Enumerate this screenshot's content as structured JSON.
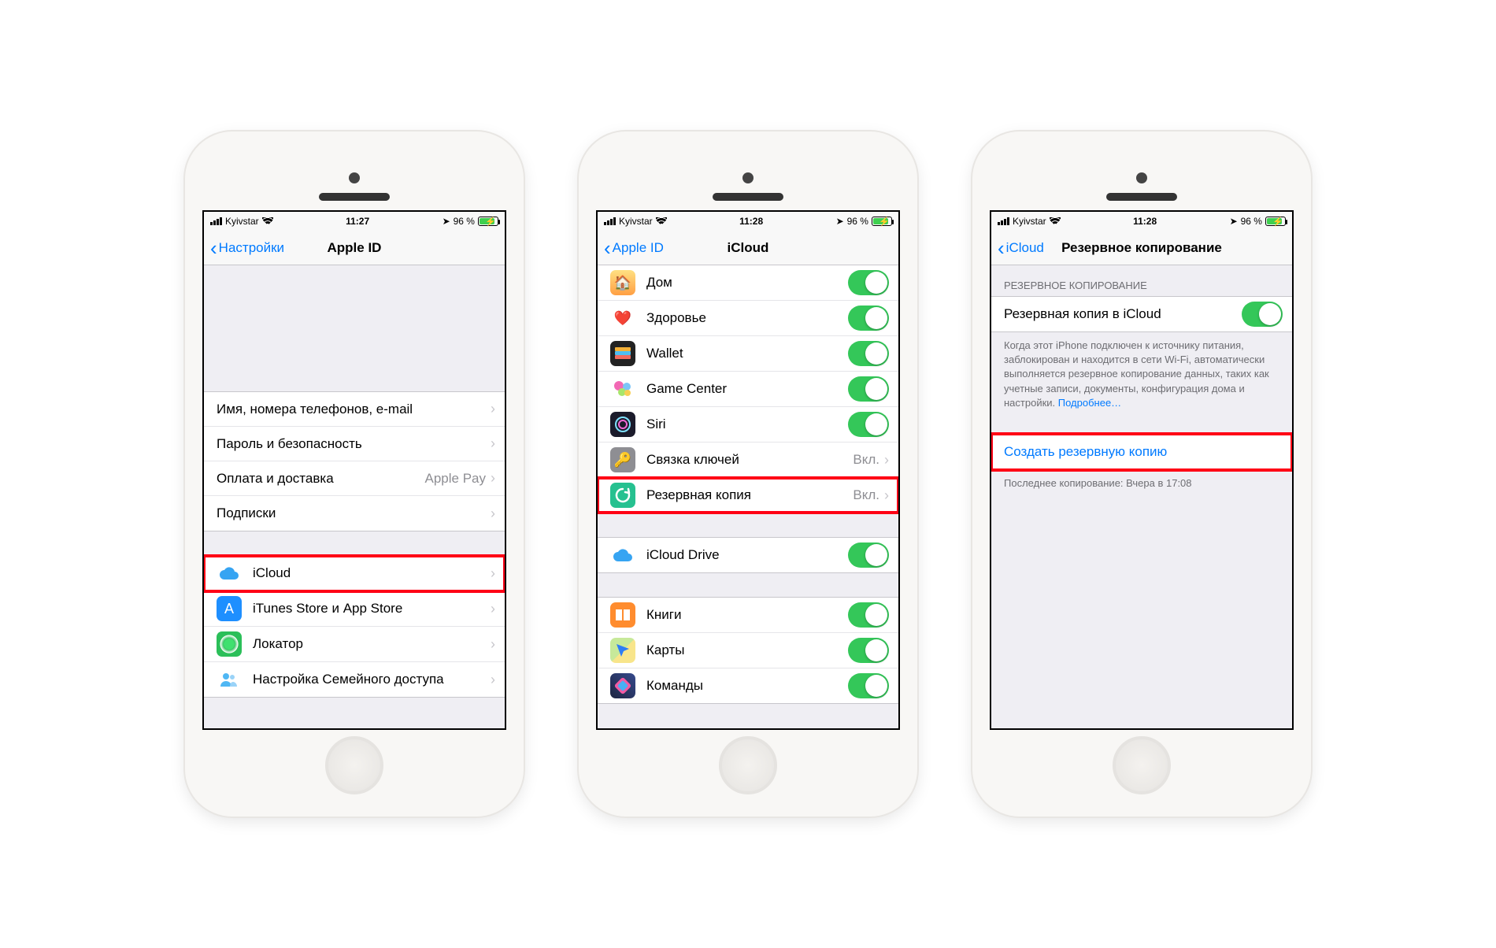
{
  "status": {
    "carrier": "Kyivstar",
    "battery_text": "96 %"
  },
  "phone1": {
    "time": "11:27",
    "back": "Настройки",
    "title": "Apple ID",
    "rows1": [
      {
        "label": "Имя, номера телефонов, e-mail"
      },
      {
        "label": "Пароль и безопасность"
      },
      {
        "label": "Оплата и доставка",
        "value": "Apple Pay"
      },
      {
        "label": "Подписки"
      }
    ],
    "rows2": [
      {
        "label": "iCloud",
        "highlight": true
      },
      {
        "label": "iTunes Store и App Store"
      },
      {
        "label": "Локатор"
      },
      {
        "label": "Настройка Семейного доступа"
      }
    ]
  },
  "phone2": {
    "time": "11:28",
    "back": "Apple ID",
    "title": "iCloud",
    "toggles1": [
      {
        "label": "Дом"
      },
      {
        "label": "Здоровье"
      },
      {
        "label": "Wallet"
      },
      {
        "label": "Game Center"
      },
      {
        "label": "Siri"
      }
    ],
    "links": [
      {
        "label": "Связка ключей",
        "value": "Вкл."
      },
      {
        "label": "Резервная копия",
        "value": "Вкл.",
        "highlight": true
      }
    ],
    "toggles2": [
      {
        "label": "iCloud Drive"
      }
    ],
    "toggles3": [
      {
        "label": "Книги"
      },
      {
        "label": "Карты"
      },
      {
        "label": "Команды"
      }
    ]
  },
  "phone3": {
    "time": "11:28",
    "back": "iCloud",
    "title": "Резервное копирование",
    "section_header": "РЕЗЕРВНОЕ КОПИРОВАНИЕ",
    "backup_label": "Резервная копия в iCloud",
    "footer_text": "Когда этот iPhone подключен к источнику питания, заблокирован и находится в сети Wi-Fi, автоматически выполняется резервное копирование данных, таких как учетные записи, документы, конфигурация дома и настройки. ",
    "footer_link": "Подробнее…",
    "backup_now": "Создать резервную копию",
    "last_backup": "Последнее копирование: Вчера в 17:08"
  }
}
